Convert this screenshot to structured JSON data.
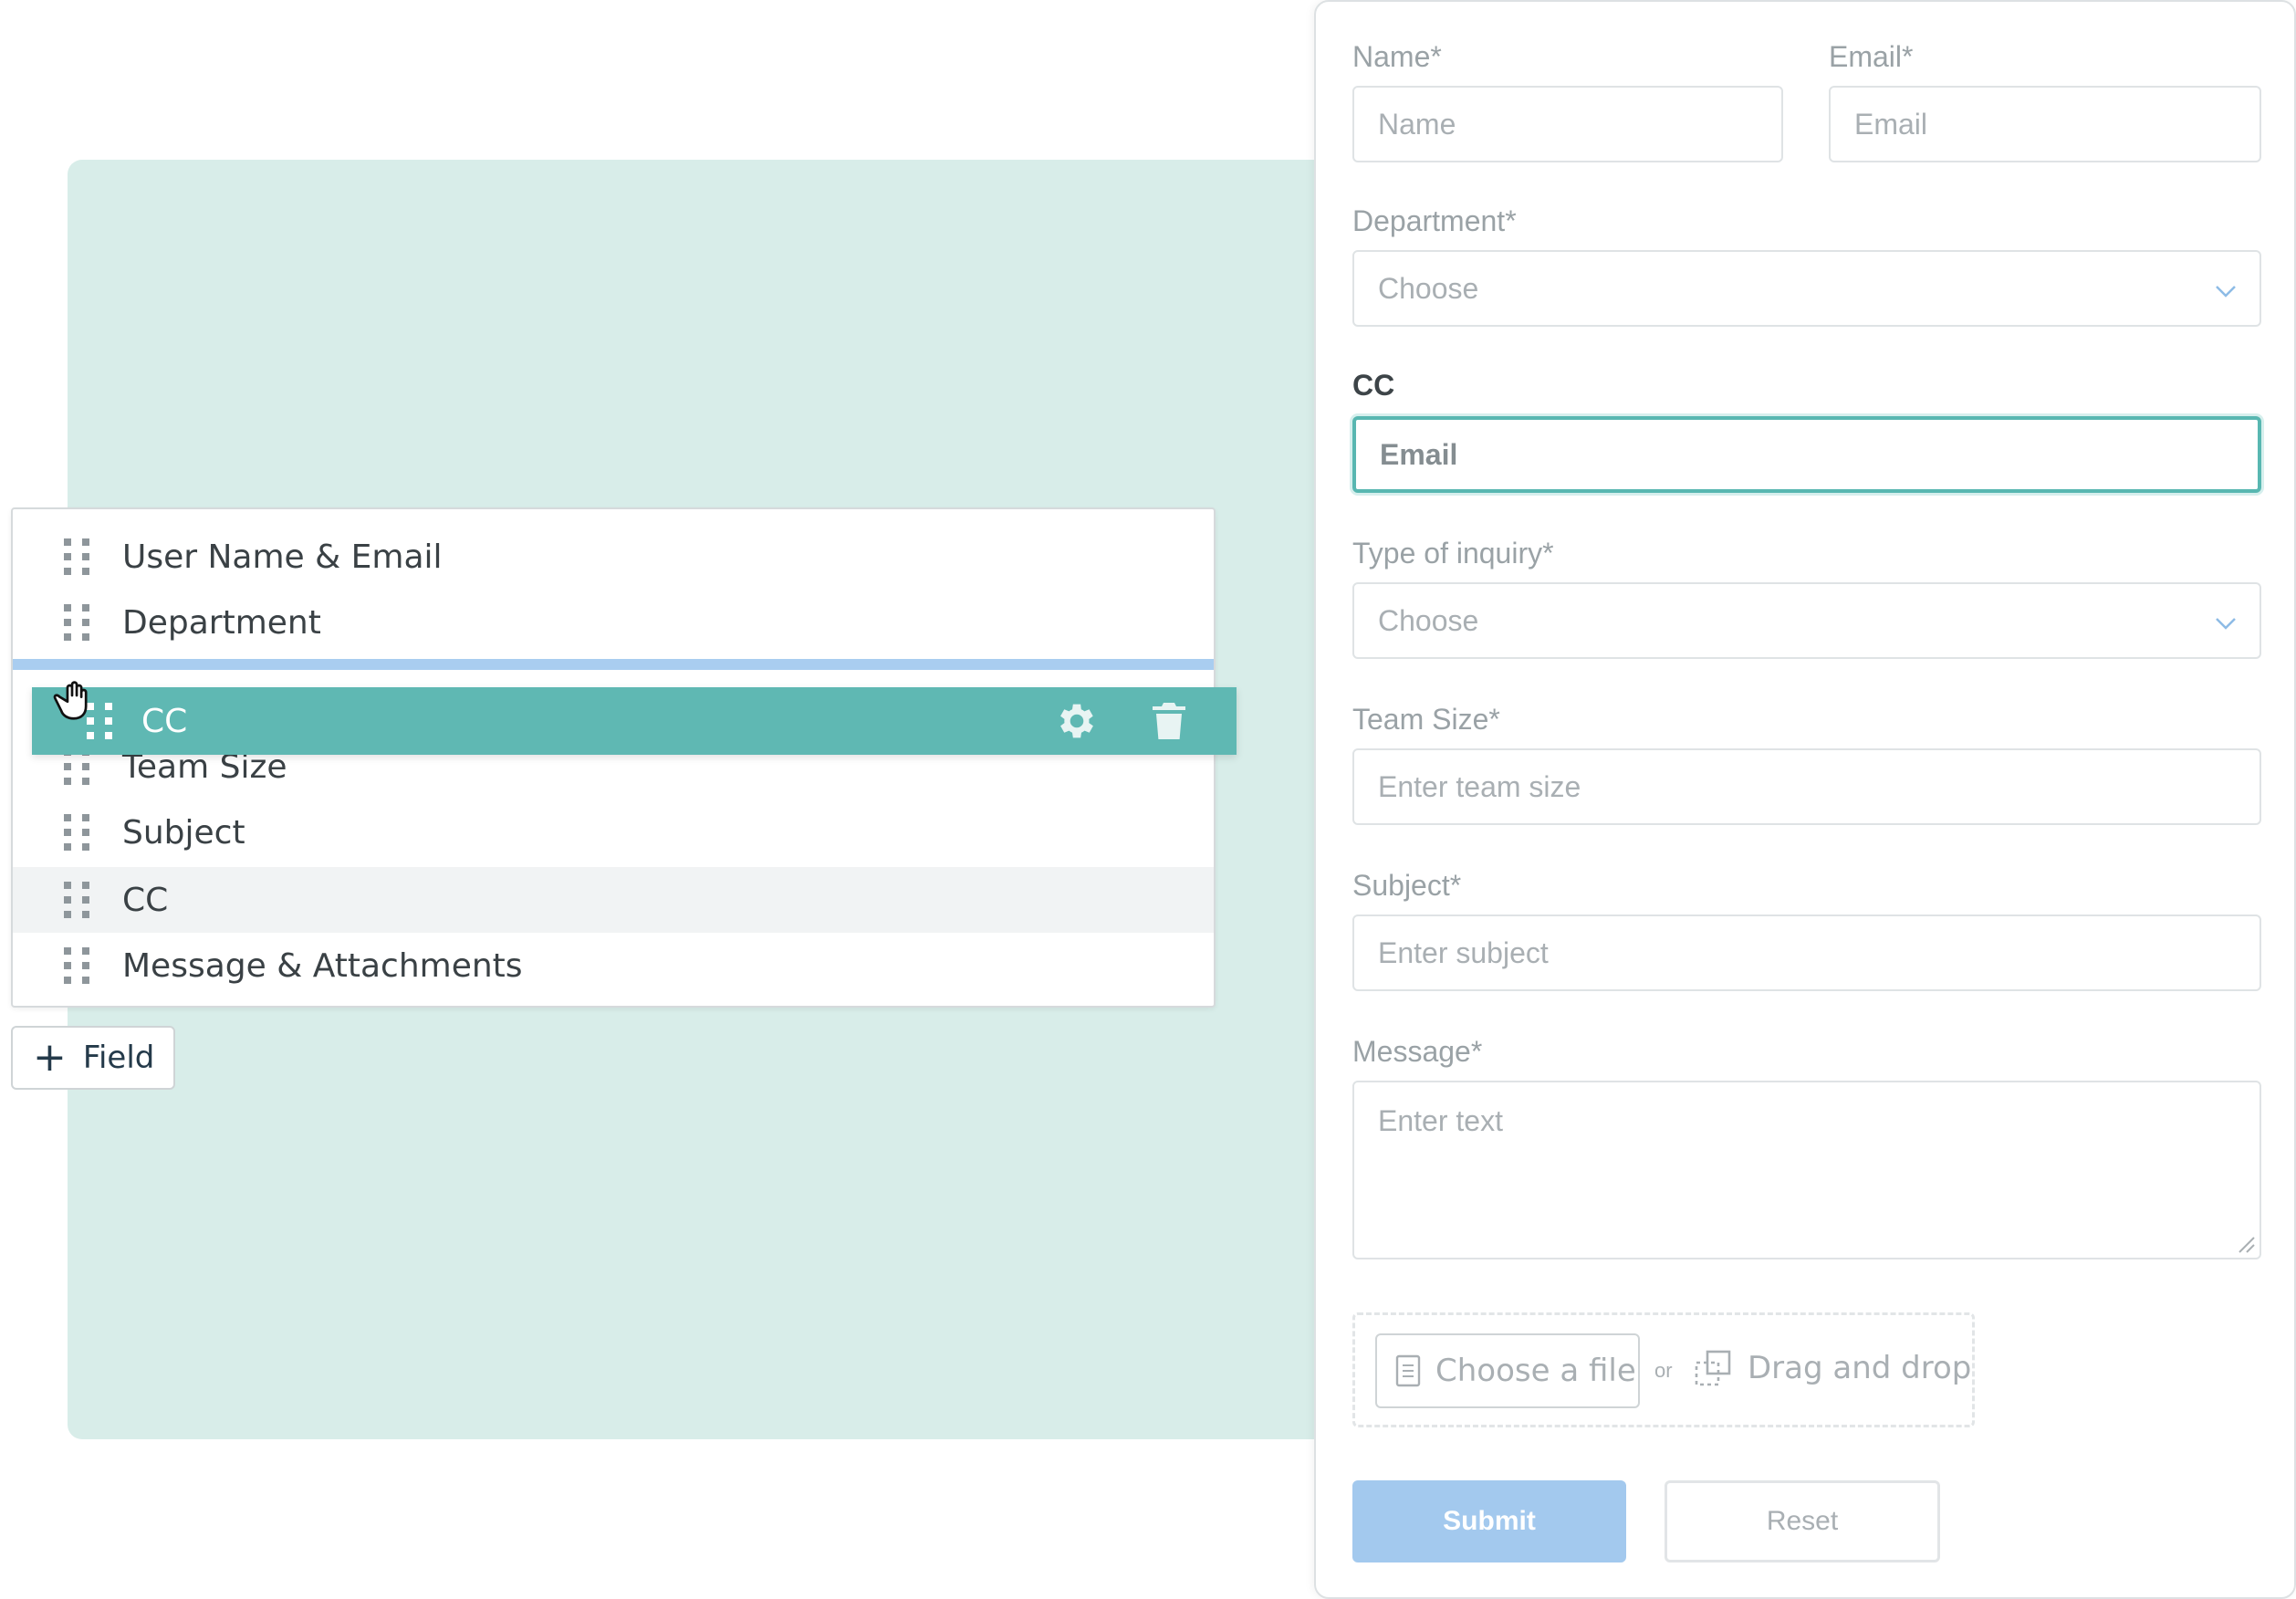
{
  "builder": {
    "fields": [
      {
        "label": "User Name & Email"
      },
      {
        "label": "Department"
      },
      {
        "label": "Team Size"
      },
      {
        "label": "Subject"
      },
      {
        "label": "CC"
      },
      {
        "label": "Message & Attachments"
      }
    ],
    "dragging": {
      "label": "CC"
    },
    "add_field_label": "Field"
  },
  "form": {
    "name": {
      "label": "Name*",
      "placeholder": "Name"
    },
    "email": {
      "label": "Email*",
      "placeholder": "Email"
    },
    "department": {
      "label": "Department*",
      "value": "Choose"
    },
    "cc": {
      "label": "CC",
      "placeholder": "Email"
    },
    "inquiry": {
      "label": "Type of inquiry*",
      "value": "Choose"
    },
    "team_size": {
      "label": "Team Size*",
      "placeholder": "Enter team size"
    },
    "subject": {
      "label": "Subject*",
      "placeholder": "Enter subject"
    },
    "message": {
      "label": "Message*",
      "placeholder": "Enter text"
    },
    "upload": {
      "choose_label": "Choose a file",
      "or_label": "or",
      "drag_label": "Drag and drop"
    },
    "submit_label": "Submit",
    "reset_label": "Reset"
  },
  "colors": {
    "accent": "#5fb8b3",
    "drop_indicator": "#a9cdf0",
    "submit": "#a3c9ee",
    "background_panel": "#d8ede9"
  },
  "icons": {
    "drag_handle": "grip-icon",
    "settings": "gear-icon",
    "delete": "trash-icon",
    "cursor": "grab-hand-icon",
    "select_arrow": "chevron-down-icon",
    "file": "document-icon",
    "drag_drop": "drag-drop-icon"
  }
}
